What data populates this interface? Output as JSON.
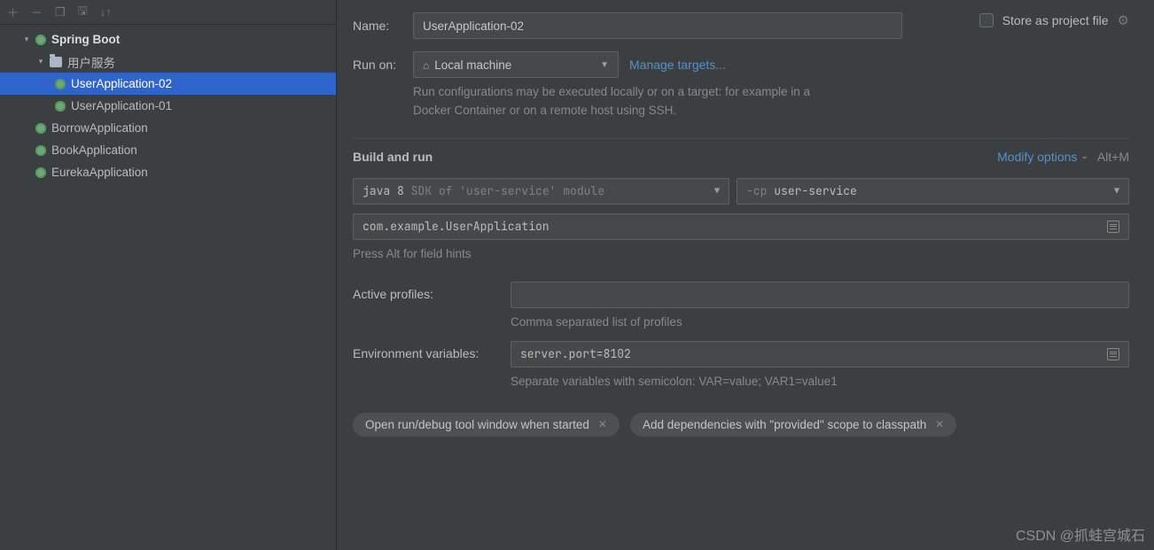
{
  "sidebar": {
    "root_label": "Spring Boot",
    "folder_label": "用户服务",
    "items": [
      {
        "label": "UserApplication-02"
      },
      {
        "label": "UserApplication-01"
      },
      {
        "label": "BorrowApplication"
      },
      {
        "label": "BookApplication"
      },
      {
        "label": "EurekaApplication"
      }
    ]
  },
  "form": {
    "name_label": "Name:",
    "name_value": "UserApplication-02",
    "store_label": "Store as project file",
    "runon_label": "Run on:",
    "runon_value": "Local machine",
    "manage_targets": "Manage targets...",
    "runon_hint": "Run configurations may be executed locally or on a target: for example in a Docker Container or on a remote host using SSH."
  },
  "build": {
    "section_title": "Build and run",
    "modify_label": "Modify options",
    "modify_shortcut": "Alt+M",
    "jre_prefix": "java 8",
    "jre_suffix": "SDK of 'user-service' module",
    "cp_prefix": "-cp",
    "cp_value": "user-service",
    "main_class": "com.example.UserApplication",
    "hints_label": "Press Alt for field hints"
  },
  "profiles": {
    "label": "Active profiles:",
    "value": "",
    "hint": "Comma separated list of profiles"
  },
  "env": {
    "label": "Environment variables:",
    "value": "server.port=8102",
    "hint": "Separate variables with semicolon: VAR=value; VAR1=value1"
  },
  "chips": [
    "Open run/debug tool window when started",
    "Add dependencies with \"provided\" scope to classpath"
  ],
  "watermark": "CSDN @抓蛙宫城石"
}
